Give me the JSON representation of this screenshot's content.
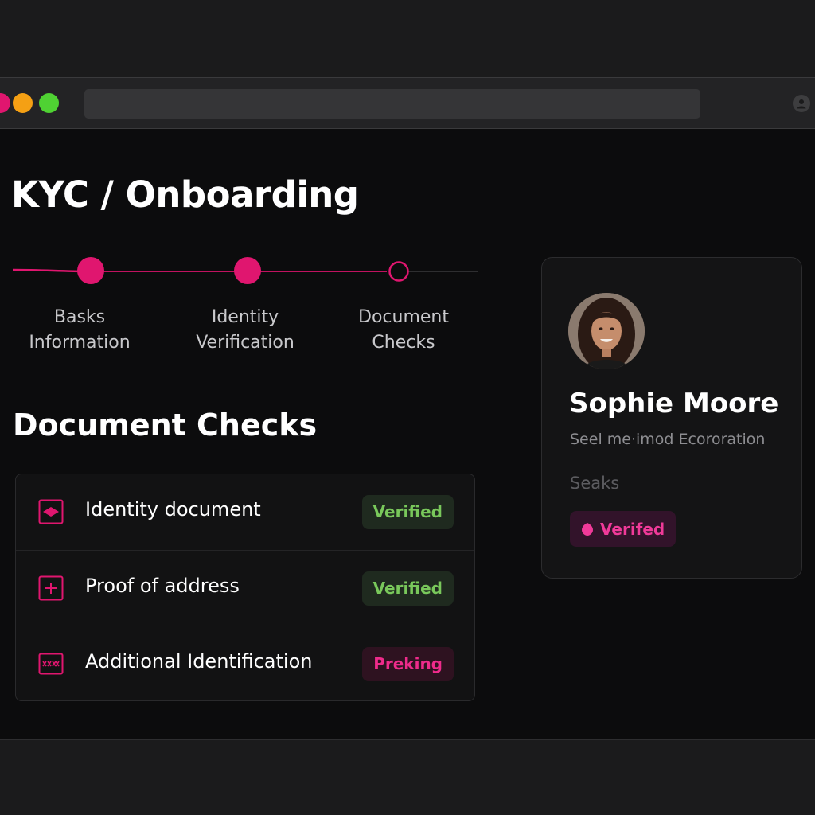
{
  "page": {
    "title": "KYC / Onboarding"
  },
  "stepper": {
    "steps": [
      {
        "label_line1": "Basks",
        "label_line2": "Information",
        "state": "complete"
      },
      {
        "label_line1": "Identity",
        "label_line2": "Verification",
        "state": "complete"
      },
      {
        "label_line1": "Document",
        "label_line2": "Checks",
        "state": "current"
      }
    ]
  },
  "checks": {
    "title": "Document Checks",
    "items": [
      {
        "label": "Identity document",
        "status": "Verified",
        "icon": "id-card-icon"
      },
      {
        "label": "Proof of address",
        "status": "Verified",
        "icon": "plus-document-icon"
      },
      {
        "label": "Additional Identification",
        "status": "Preking",
        "icon": "id-strip-icon"
      }
    ]
  },
  "profile": {
    "name": "Sophie Moore",
    "company": "Seel me·imod Ecororation",
    "field_label": "Seaks",
    "status": "Verifed"
  },
  "colors": {
    "accent": "#e0166f",
    "success": "#79c85b",
    "pending": "#ee2b8b"
  }
}
